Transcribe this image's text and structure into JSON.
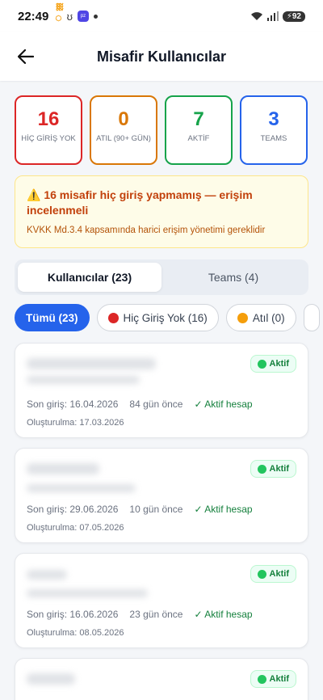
{
  "status_bar": {
    "time": "22:49",
    "battery": "92"
  },
  "header": {
    "title": "Misafir Kullanıcılar"
  },
  "stats": [
    {
      "value": "16",
      "label": "HİÇ GİRİŞ YOK",
      "color": "#dc2626"
    },
    {
      "value": "0",
      "label": "ATIL (90+ GÜN)",
      "color": "#d97706"
    },
    {
      "value": "7",
      "label": "AKTİF",
      "color": "#16a34a"
    },
    {
      "value": "3",
      "label": "TEAMS",
      "color": "#2563eb"
    }
  ],
  "warning": {
    "title": "⚠️ 16 misafir hiç giriş yapmamış — erişim incelenmeli",
    "subtitle": "KVKK Md.3.4 kapsamında harici erişim yönetimi gereklidir"
  },
  "tabs": [
    {
      "label": "Kullanıcılar (23)",
      "active": true
    },
    {
      "label": "Teams (4)",
      "active": false
    }
  ],
  "filters": [
    {
      "label": "Tümü (23)",
      "active": true,
      "dot": ""
    },
    {
      "label": "Hiç Giriş Yok (16)",
      "active": false,
      "dot": "#dc2626"
    },
    {
      "label": "Atıl (0)",
      "active": false,
      "dot": "#f59e0b"
    }
  ],
  "users": [
    {
      "status": "Aktif",
      "last_login": "Son giriş: 16.04.2026",
      "ago": "84 gün önce",
      "account": "✓ Aktif hesap",
      "created": "Oluşturulma: 17.03.2026"
    },
    {
      "status": "Aktif",
      "last_login": "Son giriş: 29.06.2026",
      "ago": "10 gün önce",
      "account": "✓ Aktif hesap",
      "created": "Oluşturulma: 07.05.2026"
    },
    {
      "status": "Aktif",
      "last_login": "Son giriş: 16.06.2026",
      "ago": "23 gün önce",
      "account": "✓ Aktif hesap",
      "created": "Oluşturulma: 08.05.2026"
    },
    {
      "status": "Aktif"
    }
  ]
}
